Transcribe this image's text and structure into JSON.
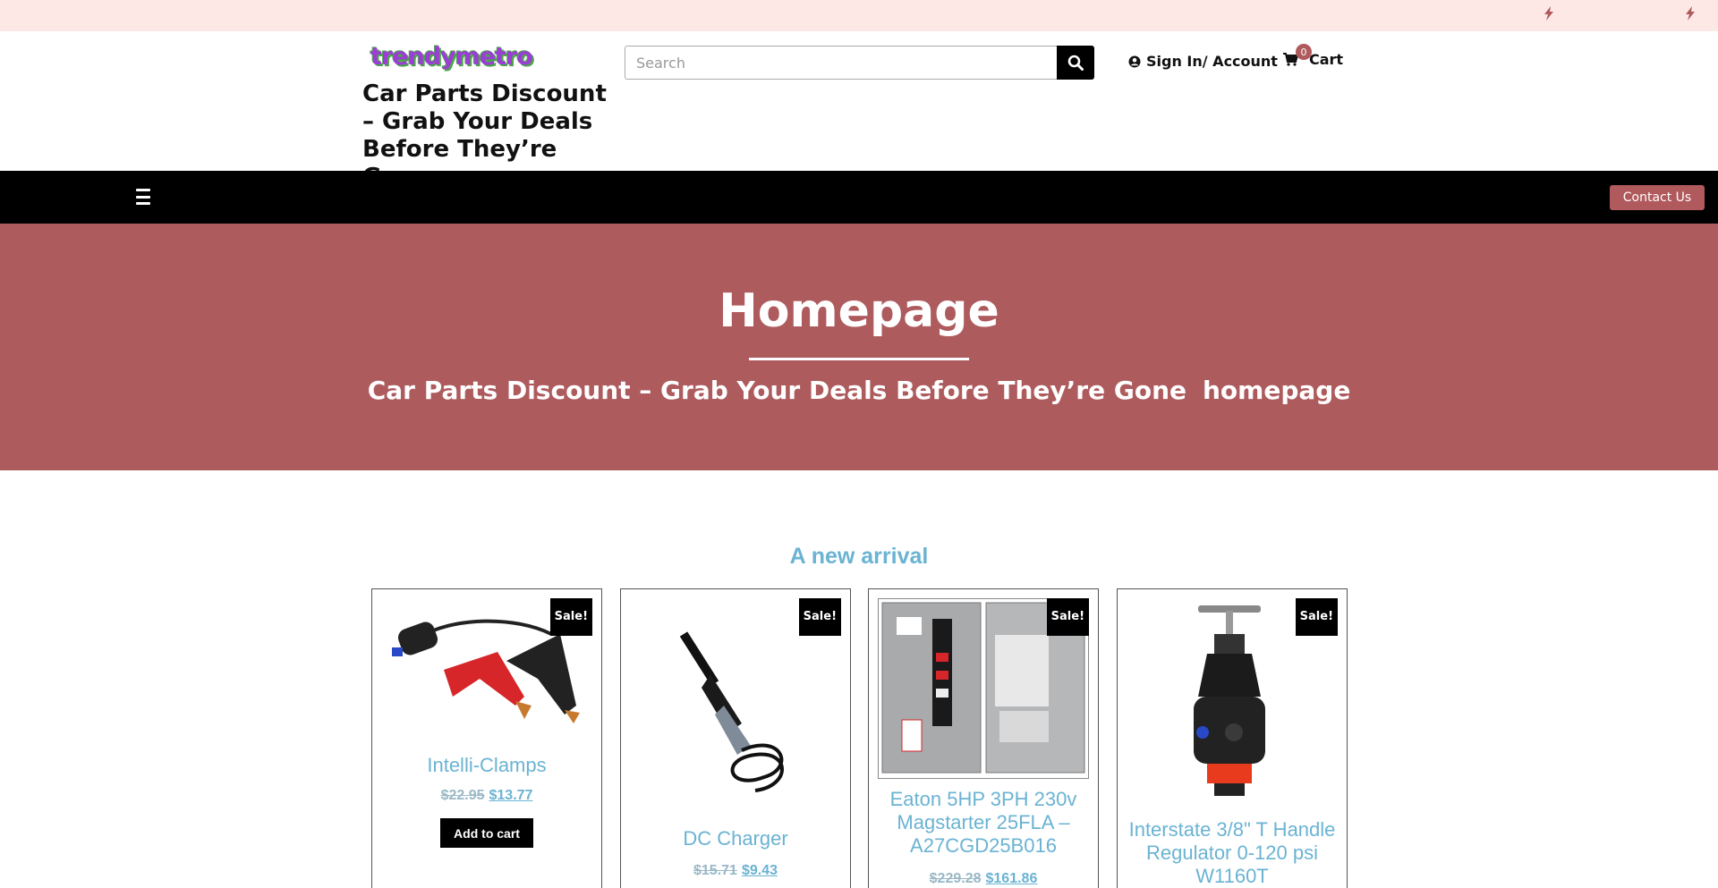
{
  "topbar": {
    "social_icons": [
      "bolt-icon",
      "bolt-icon"
    ]
  },
  "header": {
    "logo_text": "trendymetro",
    "site_title": "Car Parts Discount – Grab Your Deals Before They’re Gone",
    "search": {
      "placeholder": "Search",
      "value": ""
    },
    "account_label": "Sign In/ Account",
    "cart": {
      "count": "0",
      "label": "Cart"
    }
  },
  "nav": {
    "contact_label": "Contact Us"
  },
  "hero": {
    "title": "Homepage",
    "breadcrumb": [
      "Car Parts Discount – Grab Your Deals Before They’re Gone",
      "homepage"
    ]
  },
  "section": {
    "title": "A new arrival"
  },
  "products": [
    {
      "badge": "Sale!",
      "name": "Intelli-Clamps",
      "old_price": "$22.95",
      "new_price": "$13.77",
      "button": "Add to cart"
    },
    {
      "badge": "Sale!",
      "name": "DC Charger",
      "old_price": "$15.71",
      "new_price": "$9.43"
    },
    {
      "badge": "Sale!",
      "name": "Eaton 5HP 3PH 230v Magstarter 25FLA – A27CGD25B016",
      "old_price": "$229.28",
      "new_price": "$161.86"
    },
    {
      "badge": "Sale!",
      "name": "Interstate 3/8\" T Handle Regulator 0-120 psi W1160T"
    }
  ],
  "colors": {
    "accent": "#ae5b5e",
    "link": "#6ab3d3",
    "topbar": "#fde8e6"
  }
}
